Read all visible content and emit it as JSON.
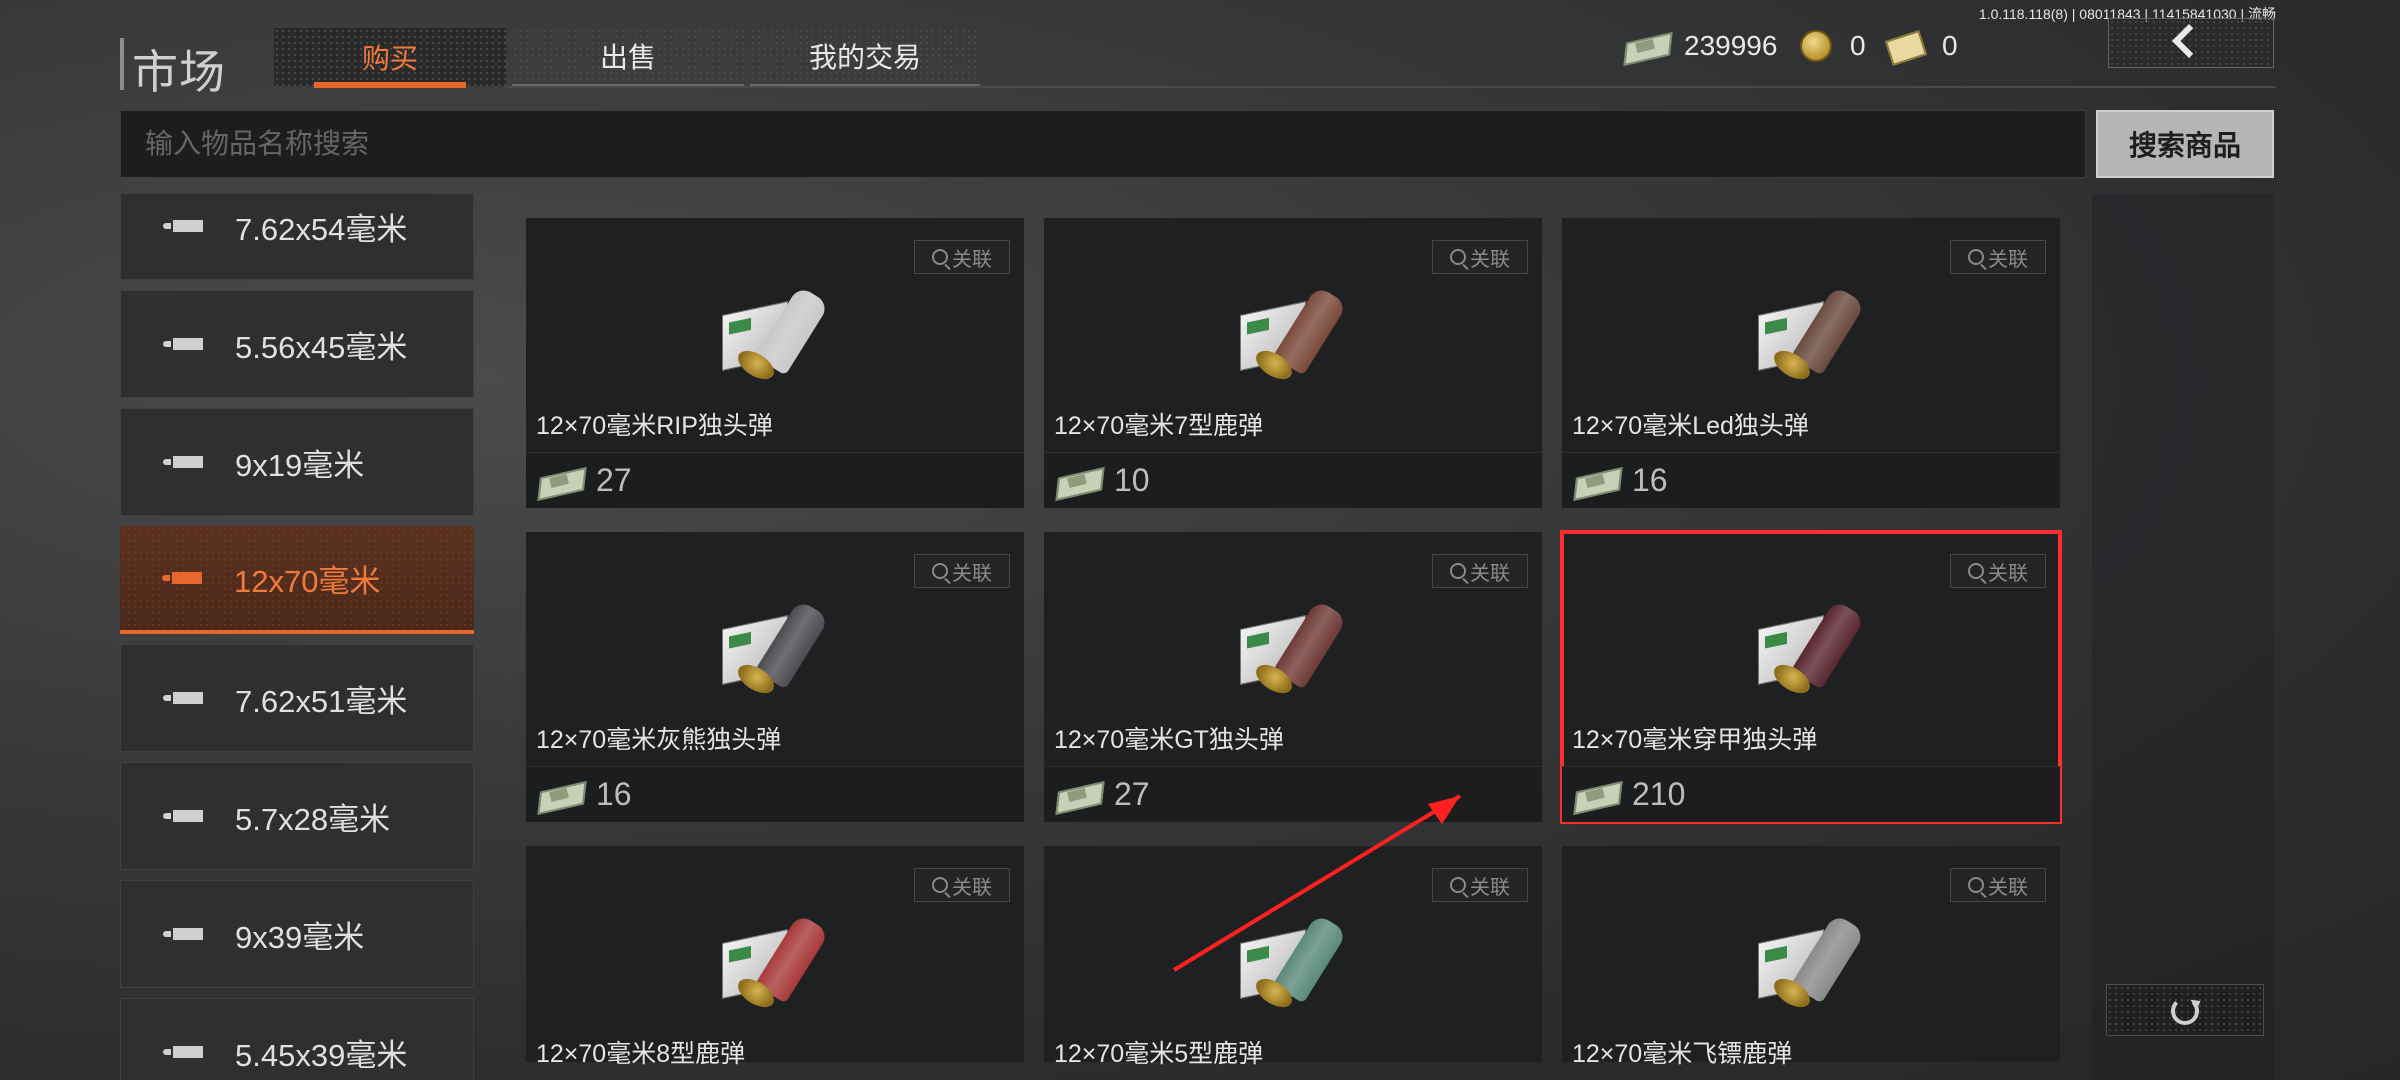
{
  "version": "1.0.118.118(8) | 08011843 | 11415841030 | 流畅",
  "title": "市场",
  "tabs": [
    {
      "label": "购买",
      "active": true
    },
    {
      "label": "出售",
      "active": false
    },
    {
      "label": "我的交易",
      "active": false
    }
  ],
  "currencies": [
    {
      "icon": "cash-icon",
      "value": "239996"
    },
    {
      "icon": "coin-icon",
      "value": "0"
    },
    {
      "icon": "bond-icon",
      "value": "0"
    }
  ],
  "search": {
    "placeholder": "输入物品名称搜索",
    "button_label": "搜索商品"
  },
  "categories": [
    {
      "label": "7.62x54毫米",
      "active": false
    },
    {
      "label": "5.56x45毫米",
      "active": false
    },
    {
      "label": "9x19毫米",
      "active": false
    },
    {
      "label": "12x70毫米",
      "active": true
    },
    {
      "label": "7.62x51毫米",
      "active": false
    },
    {
      "label": "5.7x28毫米",
      "active": false
    },
    {
      "label": "9x39毫米",
      "active": false
    },
    {
      "label": "5.45x39毫米",
      "active": false
    }
  ],
  "related_label": "关联",
  "items": [
    {
      "name": "12×70毫米RIP独头弹",
      "price": "27",
      "shell_color": "#c8c8c8"
    },
    {
      "name": "12×70毫米7型鹿弹",
      "price": "10",
      "shell_color": "#7a4a3a"
    },
    {
      "name": "12×70毫米Led独头弹",
      "price": "16",
      "shell_color": "#6a4a3e"
    },
    {
      "name": "12×70毫米灰熊独头弹",
      "price": "16",
      "shell_color": "#4a4c50"
    },
    {
      "name": "12×70毫米GT独头弹",
      "price": "27",
      "shell_color": "#6e3a36"
    },
    {
      "name": "12×70毫米穿甲独头弹",
      "price": "210",
      "shell_color": "#5a2630",
      "highlighted": true
    },
    {
      "name": "12×70毫米8型鹿弹",
      "price": "",
      "shell_color": "#a83a3a"
    },
    {
      "name": "12×70毫米5型鹿弹",
      "price": "",
      "shell_color": "#5a8a7a"
    },
    {
      "name": "12×70毫米飞镖鹿弹",
      "price": "",
      "shell_color": "#8a8a8a"
    }
  ],
  "colors": {
    "accent": "#e8672c",
    "highlight": "#ff2d2d"
  }
}
